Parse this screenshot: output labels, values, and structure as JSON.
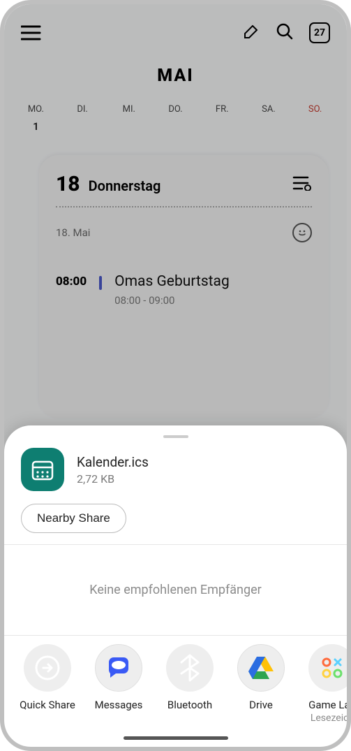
{
  "topbar": {
    "today": "27"
  },
  "month": "MAI",
  "weekday": {
    "mo": "MO.",
    "di": "DI.",
    "mi": "MI.",
    "do": "DO.",
    "fr": "FR.",
    "sa": "SA.",
    "so": "SO."
  },
  "grid": {
    "d1": "1"
  },
  "day": {
    "num": "18",
    "name": "Donnerstag",
    "dateline": "18. Mai"
  },
  "event": {
    "time": "08:00",
    "title": "Omas Geburtstag",
    "range": "08:00 - 09:00"
  },
  "share": {
    "filename": "Kalender.ics",
    "filesize": "2,72 KB",
    "nearby": "Nearby Share",
    "no_recipients": "Keine empfohlenen Empfänger",
    "targets": [
      {
        "label": "Quick Share",
        "sub": ""
      },
      {
        "label": "Messages",
        "sub": ""
      },
      {
        "label": "Bluetooth",
        "sub": ""
      },
      {
        "label": "Drive",
        "sub": ""
      },
      {
        "label": "Game Lau",
        "sub": "Lesezeich"
      }
    ]
  }
}
